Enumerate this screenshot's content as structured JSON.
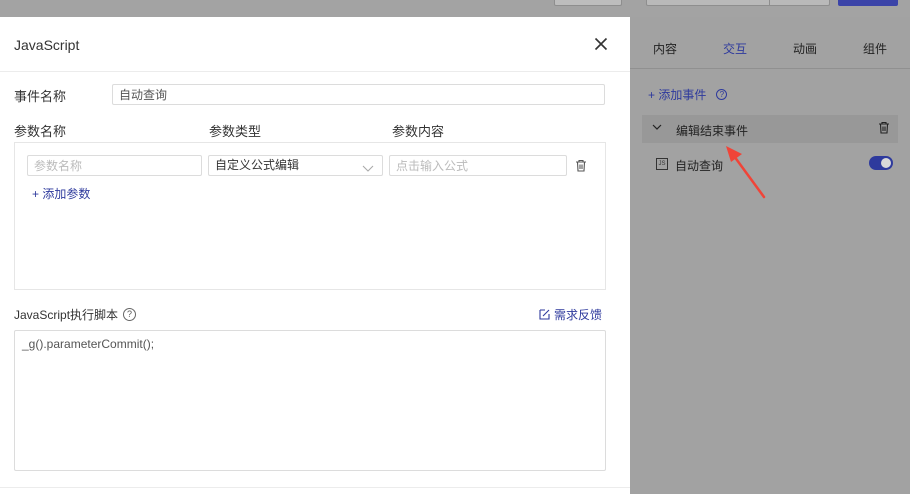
{
  "modal": {
    "title": "JavaScript",
    "event_name_label": "事件名称",
    "event_name_value": "自动查询",
    "param_headers": {
      "name": "参数名称",
      "type": "参数类型",
      "content": "参数内容"
    },
    "param_row": {
      "name_placeholder": "参数名称",
      "type_value": "自定义公式编辑",
      "content_placeholder": "点击输入公式"
    },
    "add_param_label": "+ 添加参数",
    "script_label": "JavaScript执行脚本",
    "feedback_label": "需求反馈",
    "script_code": "_g().parameterCommit();"
  },
  "right_panel": {
    "tabs": [
      {
        "label": "内容"
      },
      {
        "label": "交互"
      },
      {
        "label": "动画"
      },
      {
        "label": "组件"
      }
    ],
    "active_tab": "交互",
    "add_event_label": "+ 添加事件",
    "event": {
      "label": "编辑结束事件",
      "actions": [
        {
          "label": "自动查询",
          "enabled": true
        }
      ]
    }
  },
  "colors": {
    "accent": "#2e3a9d",
    "arrow": "#f04438",
    "overlay_bg": "#9a9a9a"
  }
}
